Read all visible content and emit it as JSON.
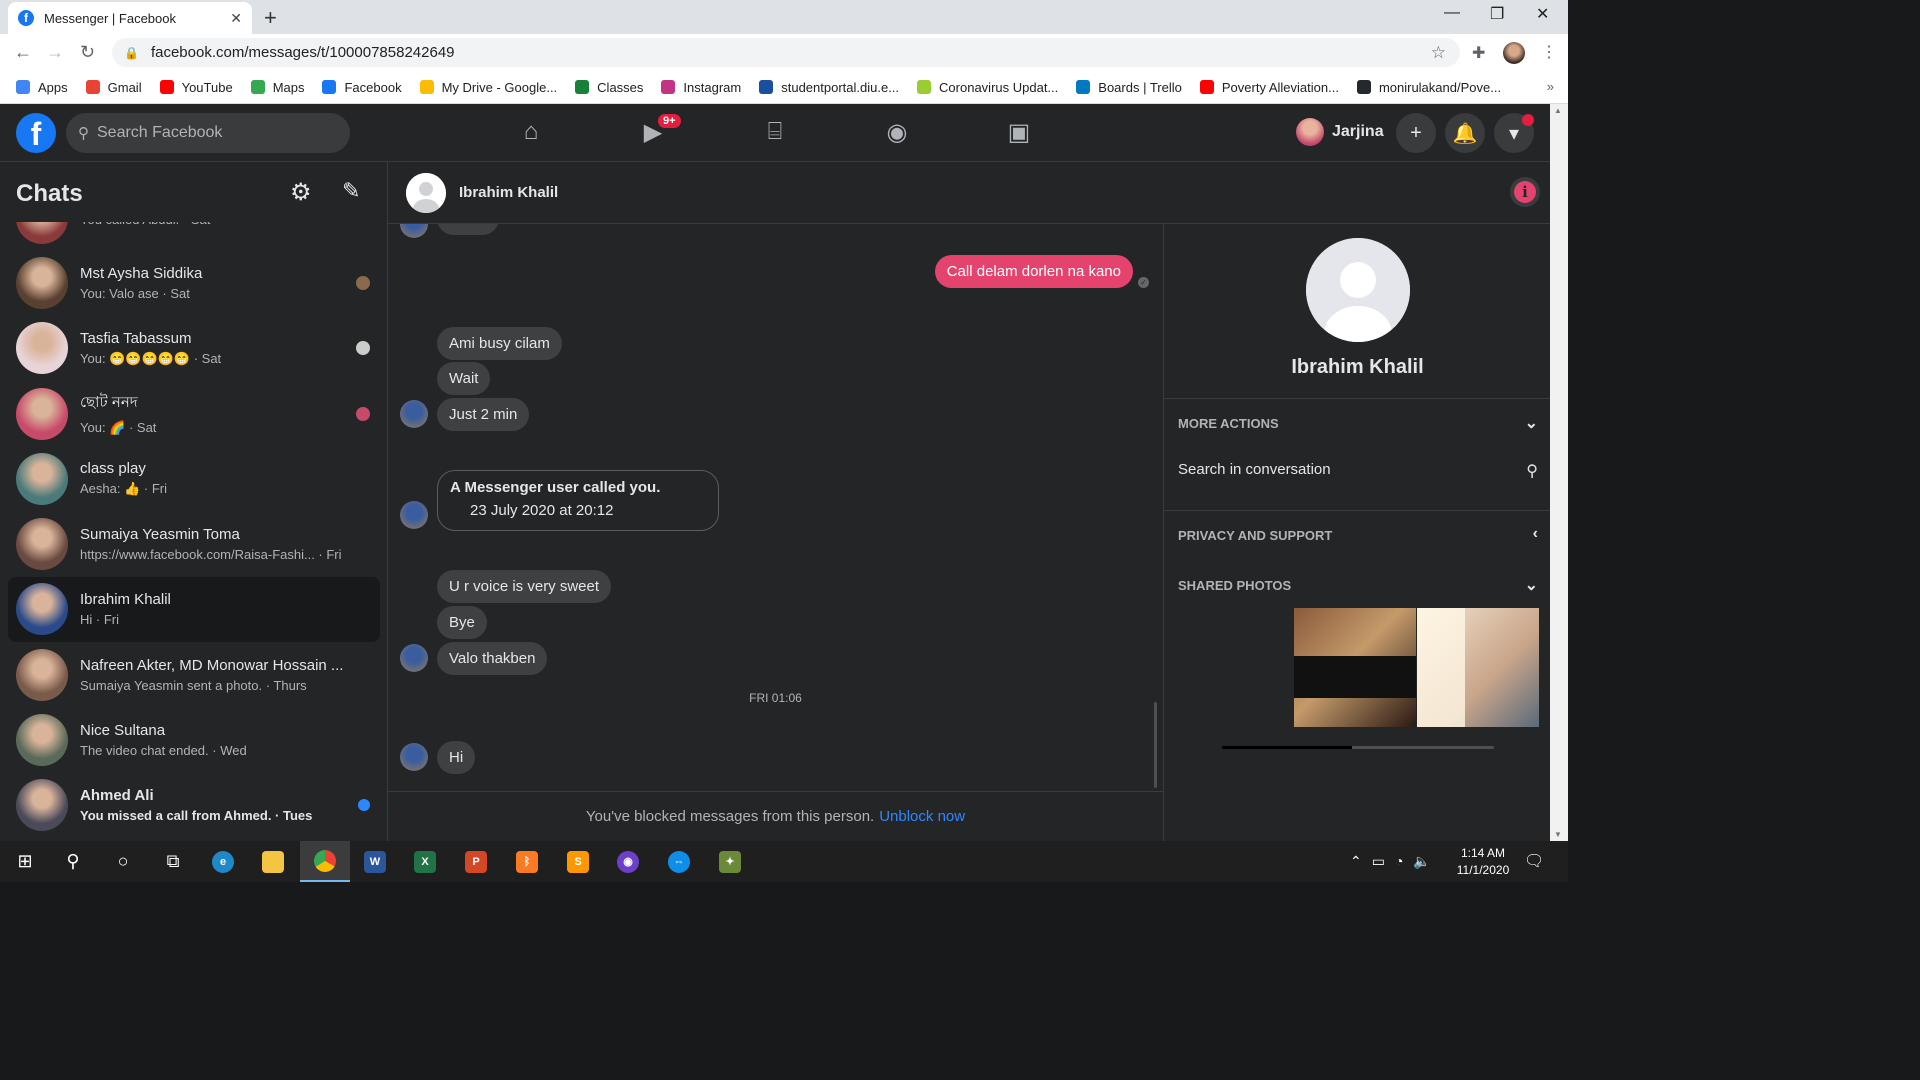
{
  "browser": {
    "tab_title": "Messenger | Facebook",
    "url": "facebook.com/messages/t/100007858242649",
    "bookmarks": [
      {
        "label": "Apps",
        "color": "#4285f4"
      },
      {
        "label": "Gmail",
        "color": "#ea4335"
      },
      {
        "label": "YouTube",
        "color": "#ff0000"
      },
      {
        "label": "Maps",
        "color": "#34a853"
      },
      {
        "label": "Facebook",
        "color": "#1877f2"
      },
      {
        "label": "My Drive - Google...",
        "color": "#fbbc04"
      },
      {
        "label": "Classes",
        "color": "#188038"
      },
      {
        "label": "Instagram",
        "color": "#c13584"
      },
      {
        "label": "studentportal.diu.e...",
        "color": "#1a4fa0"
      },
      {
        "label": "Coronavirus Updat...",
        "color": "#9acd32"
      },
      {
        "label": "Boards | Trello",
        "color": "#0079bf"
      },
      {
        "label": "Poverty Alleviation...",
        "color": "#ff0000"
      },
      {
        "label": "monirulakand/Pove...",
        "color": "#24292e"
      }
    ]
  },
  "fb_header": {
    "search_placeholder": "Search Facebook",
    "watch_badge": "9+",
    "user_name": "Jarjina"
  },
  "sidebar": {
    "title": "Chats",
    "chats": [
      {
        "name": "",
        "preview": "You called Abdul. · Sat",
        "avatar_color": "#8a3a3a",
        "active": false,
        "unread": false,
        "seen_color": ""
      },
      {
        "name": "Mst Aysha Siddika",
        "preview": "You: Valo ase · Sat",
        "avatar_color": "#5a4030",
        "active": false,
        "unread": false,
        "seen_color": "#8a6a4a"
      },
      {
        "name": "Tasfia Tabassum",
        "preview": "You: 😁😁😁😁😁 · Sat",
        "avatar_color": "#e8d4d8",
        "active": false,
        "unread": false,
        "seen_color": "#cccccc"
      },
      {
        "name": "ছোট ননদ",
        "preview": "You: 🌈 · Sat",
        "avatar_color": "#c84a6a",
        "active": false,
        "unread": false,
        "seen_color": "#c84a6a"
      },
      {
        "name": "class play",
        "preview": "Aesha: 👍 · Fri",
        "avatar_color": "#4a7a7a",
        "active": false,
        "unread": false,
        "seen_color": ""
      },
      {
        "name": "Sumaiya Yeasmin Toma",
        "preview": "https://www.facebook.com/Raisa-Fashi... · Fri",
        "avatar_color": "#6a4a40",
        "active": false,
        "unread": false,
        "seen_color": ""
      },
      {
        "name": "Ibrahim Khalil",
        "preview": "Hi · Fri",
        "avatar_color": "#2a4a8a",
        "active": true,
        "unread": false,
        "seen_color": ""
      },
      {
        "name": "Nafreen Akter, MD Monowar Hossain ...",
        "preview": "Sumaiya Yeasmin sent a photo. · Thurs",
        "avatar_color": "#7a5a4a",
        "active": false,
        "unread": false,
        "seen_color": ""
      },
      {
        "name": "Nice Sultana",
        "preview": "The video chat ended. · Wed",
        "avatar_color": "#5a6a5a",
        "active": false,
        "unread": false,
        "seen_color": ""
      },
      {
        "name": "Ahmed Ali",
        "preview": "You missed a call from Ahmed. · Tues",
        "avatar_color": "#4a4a5a",
        "active": false,
        "unread": true,
        "seen_color": ""
      }
    ]
  },
  "conversation": {
    "name": "Ibrahim Khalil",
    "clipped_top": "Bolen",
    "messages": {
      "mine1": "Call delam dorlen na kano",
      "m1": "Ami busy cilam",
      "m2": "Wait",
      "m3": "Just 2 min",
      "call_title": "A Messenger user called you.",
      "call_date": "23 July 2020 at 20:12",
      "m4": "U r voice is very sweet",
      "m5": "Bye",
      "m6": "Valo thakben",
      "timestamp": "FRI 01:06",
      "m7": "Hi"
    },
    "blocked_text": "You've blocked messages from this person.",
    "unblock_label": "Unblock now"
  },
  "info_panel": {
    "name": "Ibrahim Khalil",
    "more_actions": "MORE ACTIONS",
    "search_conv": "Search in conversation",
    "privacy": "PRIVACY AND SUPPORT",
    "shared_photos": "SHARED PHOTOS"
  },
  "taskbar": {
    "time": "1:14 AM",
    "date": "11/1/2020"
  }
}
